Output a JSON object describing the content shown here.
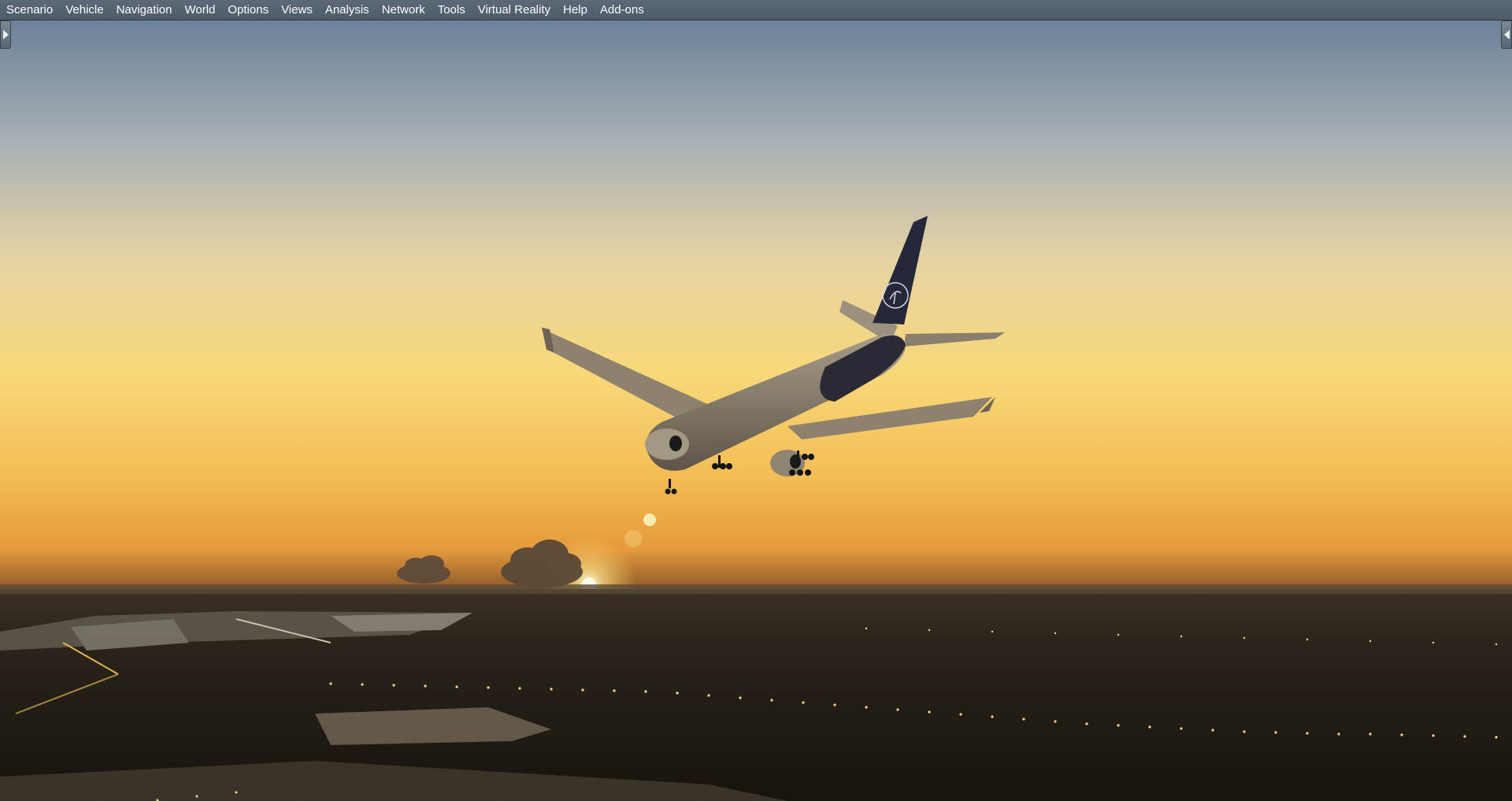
{
  "menu": {
    "items": [
      {
        "id": "scenario",
        "label": "Scenario"
      },
      {
        "id": "vehicle",
        "label": "Vehicle"
      },
      {
        "id": "navigation",
        "label": "Navigation"
      },
      {
        "id": "world",
        "label": "World"
      },
      {
        "id": "options",
        "label": "Options"
      },
      {
        "id": "views",
        "label": "Views"
      },
      {
        "id": "analysis",
        "label": "Analysis"
      },
      {
        "id": "network",
        "label": "Network"
      },
      {
        "id": "tools",
        "label": "Tools"
      },
      {
        "id": "virtual-reality",
        "label": "Virtual Reality"
      },
      {
        "id": "help",
        "label": "Help"
      },
      {
        "id": "add-ons",
        "label": "Add-ons"
      }
    ]
  },
  "panels": {
    "left_tab_icon": "expand-right-arrow-icon",
    "right_tab_icon": "expand-left-arrow-icon"
  },
  "scene": {
    "description_icon": "aircraft-on-approach-sunset-view",
    "colors": {
      "sky_top": "#6d8199",
      "sky_mid": "#e9cf98",
      "horizon": "#f6c25a",
      "ground": "#1f1a12"
    }
  }
}
